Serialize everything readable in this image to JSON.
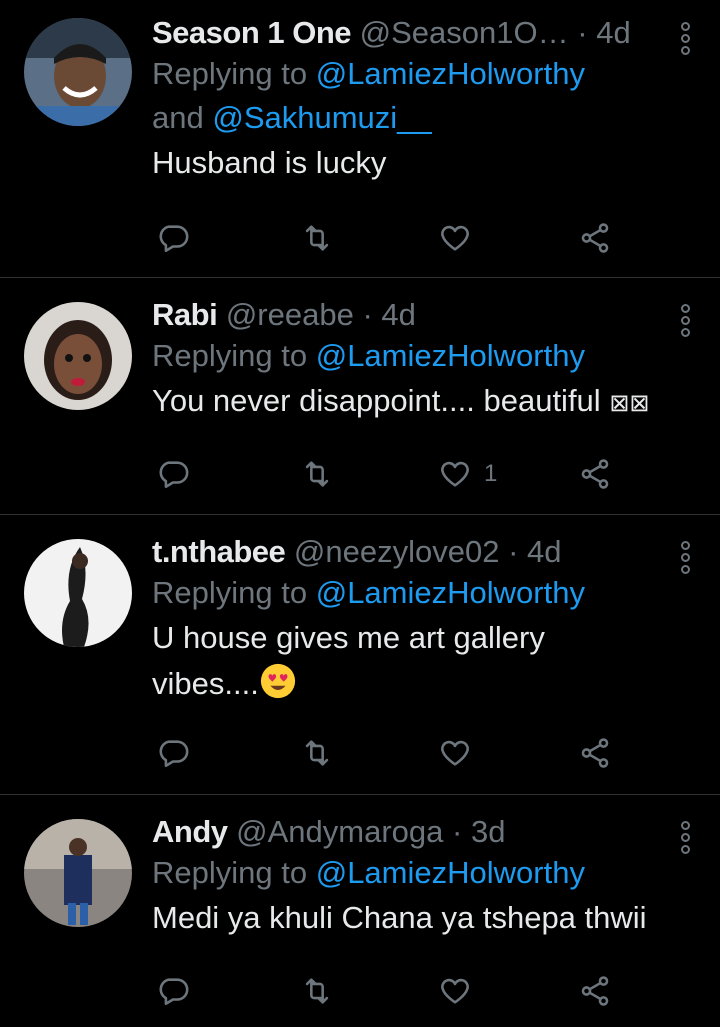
{
  "tweets": [
    {
      "name": "Season 1 One",
      "handle": "@Season1O…",
      "dot": "·",
      "time": "4d",
      "reply_prefix": "Replying to",
      "mention1": "@LamiezHolworthy",
      "reply_and": "and",
      "mention2": "@Sakhumuzi__",
      "text": "Husband is lucky",
      "like_count": ""
    },
    {
      "name": "Rabi",
      "handle": "@reeabe",
      "dot": "·",
      "time": "4d",
      "reply_prefix": "Replying to",
      "mention1": "@LamiezHolworthy",
      "text": "You never disappoint.... beautiful",
      "text_suffix": "⊠⊠",
      "like_count": "1"
    },
    {
      "name": "t.nthabee",
      "handle": "@neezylove02",
      "dot": "·",
      "time": "4d",
      "reply_prefix": "Replying to",
      "mention1": "@LamiezHolworthy",
      "text_line1": "U house gives me art gallery",
      "text_line2": "vibes....",
      "like_count": ""
    },
    {
      "name": "Andy",
      "handle": "@Andymaroga",
      "dot": "·",
      "time": "3d",
      "reply_prefix": "Replying to",
      "mention1": "@LamiezHolworthy",
      "text": "Medi ya khuli Chana ya tshepa thwii",
      "like_count": ""
    }
  ],
  "icons": {
    "reply": "reply-icon",
    "retweet": "retweet-icon",
    "like": "heart-icon",
    "share": "share-icon",
    "more": "more-vertical-icon"
  },
  "colors": {
    "background": "#000000",
    "mention": "#1d9bf0",
    "muted": "#6e767d",
    "text": "#e7e9ea"
  }
}
